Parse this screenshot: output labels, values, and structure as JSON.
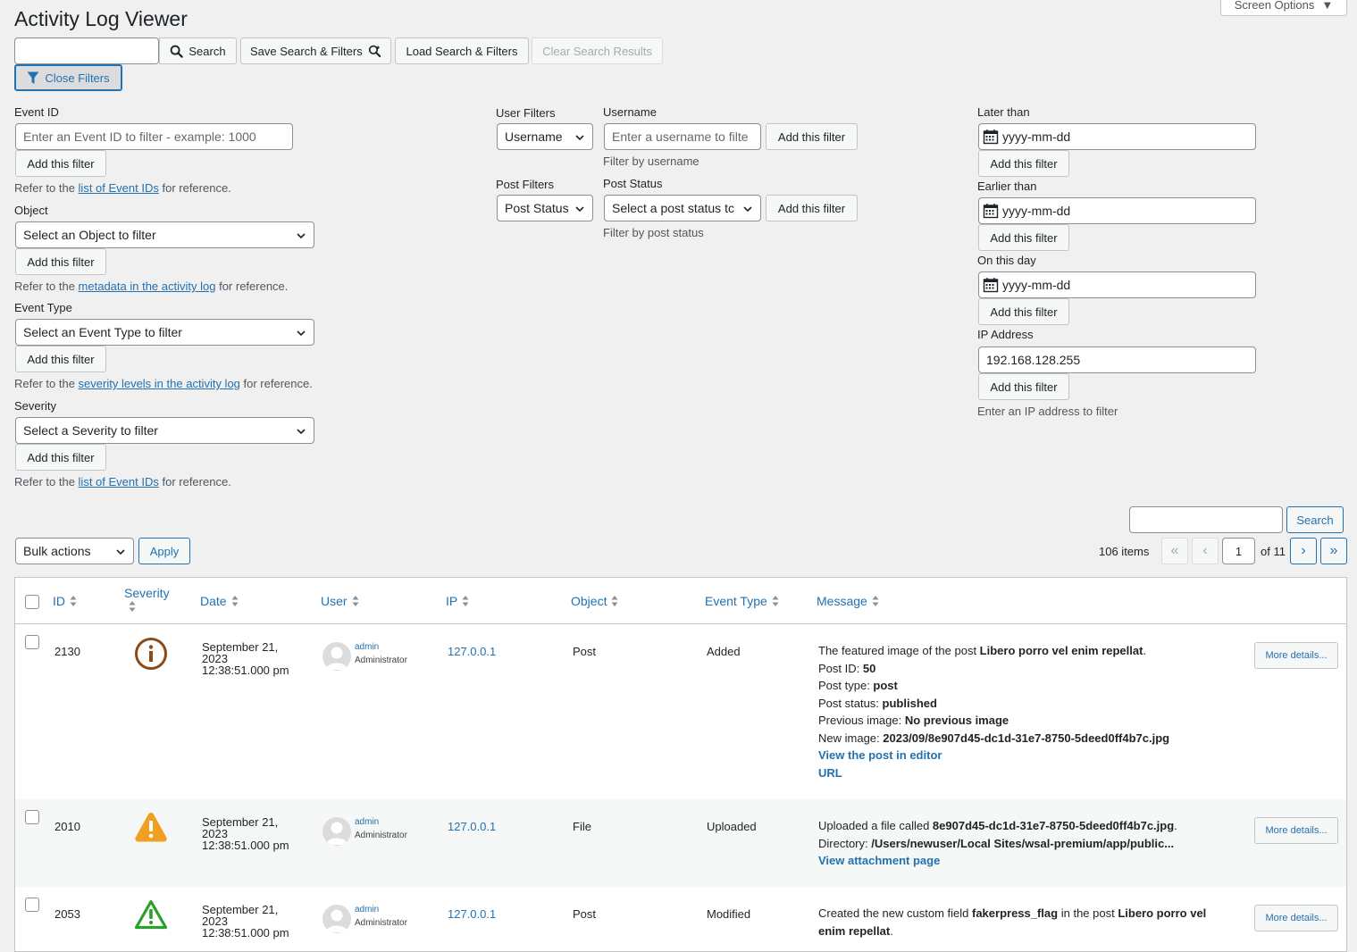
{
  "page": {
    "title": "Activity Log Viewer",
    "screen_options": "Screen Options"
  },
  "toolbar": {
    "search_value": "",
    "search_label": "Search",
    "save_label": "Save Search & Filters",
    "load_label": "Load Search & Filters",
    "clear_label": "Clear Search Results",
    "close_filters_label": "Close Filters"
  },
  "filters": {
    "event_id": {
      "label": "Event ID",
      "placeholder": "Enter an Event ID to filter - example: 1000",
      "add": "Add this filter",
      "ref_before": "Refer to the ",
      "ref_link": "list of Event IDs",
      "ref_after": " for reference."
    },
    "object": {
      "label": "Object",
      "select": "Select an Object to filter",
      "add": "Add this filter",
      "ref_before": "Refer to the ",
      "ref_link": "metadata in the activity log",
      "ref_after": " for reference."
    },
    "event_type": {
      "label": "Event Type",
      "select": "Select an Event Type to filter",
      "add": "Add this filter",
      "ref_before": "Refer to the ",
      "ref_link": "severity levels in the activity log",
      "ref_after": " for reference."
    },
    "severity": {
      "label": "Severity",
      "select": "Select a Severity to filter",
      "add": "Add this filter",
      "ref_before": "Refer to the ",
      "ref_link": "list of Event IDs",
      "ref_after": " for reference."
    },
    "user": {
      "group_label": "User Filters",
      "select": "Username",
      "field_label": "Username",
      "placeholder": "Enter a username to filte",
      "add": "Add this filter",
      "hint": "Filter by username"
    },
    "post": {
      "group_label": "Post Filters",
      "select": "Post Status",
      "field_label": "Post Status",
      "status_select": "Select a post status tc",
      "add": "Add this filter",
      "hint": "Filter by post status"
    },
    "later_than": {
      "label": "Later than",
      "placeholder": "yyyy-mm-dd",
      "add": "Add this filter"
    },
    "earlier_than": {
      "label": "Earlier than",
      "placeholder": "yyyy-mm-dd",
      "add": "Add this filter"
    },
    "on_this_day": {
      "label": "On this day",
      "placeholder": "yyyy-mm-dd",
      "add": "Add this filter"
    },
    "ip": {
      "label": "IP Address",
      "value": "192.168.128.255",
      "add": "Add this filter",
      "hint": "Enter an IP address to filter"
    }
  },
  "list": {
    "search_label": "Search",
    "bulk_actions": "Bulk actions",
    "apply": "Apply",
    "items_count": "106 items",
    "current_page": "1",
    "of_pages": "of 11",
    "first": "«",
    "prev": "‹",
    "next": "›",
    "last": "»"
  },
  "table": {
    "columns": {
      "id": "ID",
      "severity": "Severity",
      "date": "Date",
      "user": "User",
      "ip": "IP",
      "object": "Object",
      "event_type": "Event Type",
      "message": "Message"
    },
    "more_details": "More details...",
    "rows": [
      {
        "id": "2130",
        "severity_icon": "info-icon",
        "severity_color": "#8a4b19",
        "date_line1": "September 21,",
        "date_line2": "2023",
        "date_line3": "12:38:51.000 pm",
        "user_name": "admin",
        "user_role": "Administrator",
        "ip": "127.0.0.1",
        "object": "Post",
        "event_type": "Added",
        "message": {
          "l1_text": "The featured image of the post ",
          "l1_bold": "Libero porro vel enim repellat",
          "l1_end": ".",
          "post_id_label": "Post ID: ",
          "post_id": "50",
          "post_type_label": "Post type: ",
          "post_type": "post",
          "post_status_label": "Post status: ",
          "post_status": "published",
          "prev_image_label": "Previous image: ",
          "prev_image": "No previous image",
          "new_image_label": "New image: ",
          "new_image": "2023/09/8e907d45-dc1d-31e7-8750-5deed0ff4b7c.jpg",
          "link1": "View the post in editor",
          "link2": "URL"
        }
      },
      {
        "id": "2010",
        "severity_icon": "warning-icon",
        "severity_color": "#f0a020",
        "date_line1": "September 21,",
        "date_line2": "2023",
        "date_line3": "12:38:51.000 pm",
        "user_name": "admin",
        "user_role": "Administrator",
        "ip": "127.0.0.1",
        "object": "File",
        "event_type": "Uploaded",
        "message": {
          "l1_text": "Uploaded a file called ",
          "l1_bold": "8e907d45-dc1d-31e7-8750-5deed0ff4b7c.jpg",
          "l1_end": ".",
          "dir_label": "Directory: ",
          "dir": "/Users/newuser/Local Sites/wsal-premium/app/public...",
          "link1": "View attachment page"
        }
      },
      {
        "id": "2053",
        "severity_icon": "alert-triangle-icon",
        "severity_color": "#2ca02c",
        "date_line1": "September 21,",
        "date_line2": "2023",
        "date_line3": "12:38:51.000 pm",
        "user_name": "admin",
        "user_role": "Administrator",
        "ip": "127.0.0.1",
        "object": "Post",
        "event_type": "Modified",
        "message": {
          "l1_text": "Created the new custom field ",
          "l1_bold": "fakerpress_flag",
          "l1_mid": " in the post ",
          "l1_bold2": "Libero porro vel",
          "l2_bold": "enim repellat",
          "l2_end": "."
        }
      }
    ]
  }
}
